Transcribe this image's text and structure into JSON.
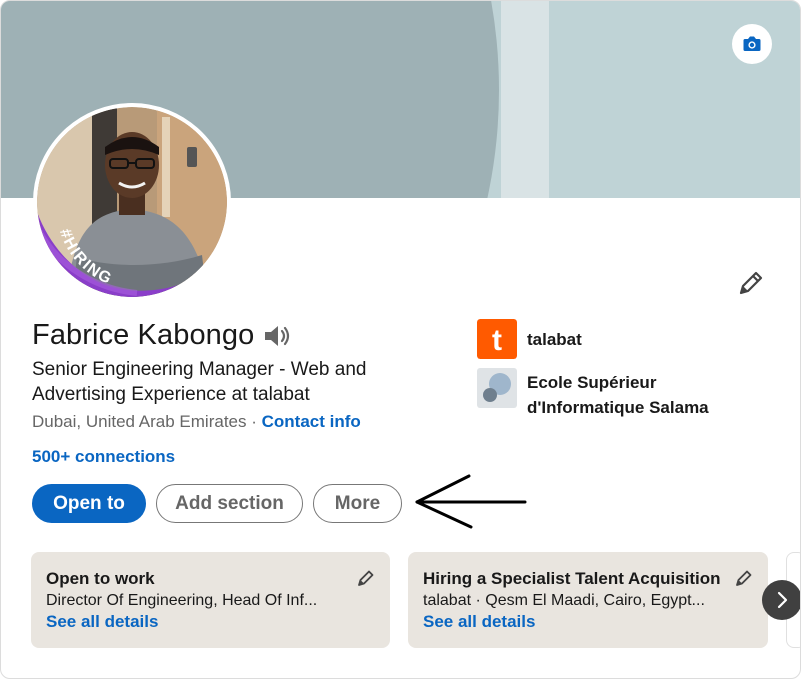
{
  "profile": {
    "name": "Fabrice Kabongo",
    "headline": "Senior Engineering Manager - Web and Advertising Experience at talabat",
    "location": "Dubai, United Arab Emirates",
    "separator": " · ",
    "contact_info_label": "Contact info",
    "connections_label": "500+ connections",
    "avatar_frame_text": "#HIRING"
  },
  "experience": [
    {
      "label": "talabat",
      "logo_letter": "t",
      "logo_color": "#ff5a00"
    },
    {
      "label": "Ecole Supérieur d'Informatique Salama"
    }
  ],
  "actions": {
    "open_to_label": "Open to",
    "add_section_label": "Add section",
    "more_label": "More"
  },
  "cards": [
    {
      "title": "Open to work",
      "subtitle": "Director Of Engineering, Head Of Inf...",
      "details_label": "See all details"
    },
    {
      "title": "Hiring a Specialist Talent Acquisition",
      "subtitle": "talabat · Qesm El Maadi, Cairo, Egypt...",
      "details_label": "See all details"
    }
  ],
  "icons": {
    "camera": "camera-icon",
    "edit": "pencil-icon",
    "speaker": "speaker-icon",
    "next": "chevron-right-icon",
    "annotation": "arrow-left-icon"
  },
  "colors": {
    "accent": "#0a66c2",
    "banner_light": "#bfd3d6",
    "banner_dark": "#9eb1b5",
    "card_bg": "#e9e5df",
    "hiring_purple": "#8a3ec9"
  }
}
